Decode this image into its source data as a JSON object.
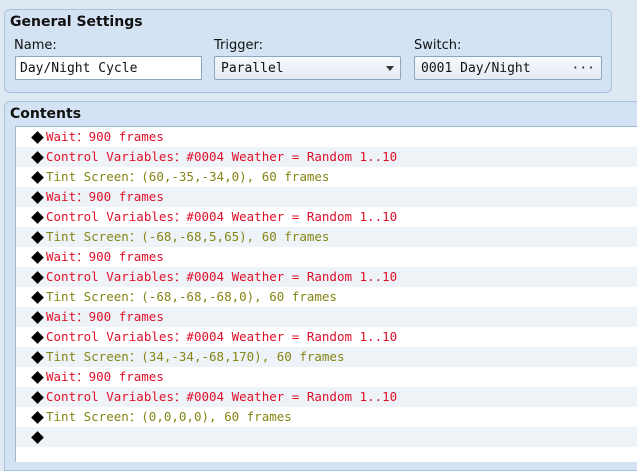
{
  "general": {
    "title": "General Settings",
    "name_label": "Name:",
    "name_value": "Day/Night Cycle",
    "trigger_label": "Trigger:",
    "trigger_value": "Parallel",
    "switch_label": "Switch:",
    "switch_value": "0001 Day/Night",
    "switch_button": "···"
  },
  "contents": {
    "title": "Contents",
    "commands": [
      {
        "text": "Wait：900 frames",
        "color": "#e0102a"
      },
      {
        "text": "Control Variables：#0004 Weather = Random 1..10",
        "color": "#e0102a"
      },
      {
        "text": "Tint Screen：(60,-35,-34,0), 60 frames",
        "color": "#858515"
      },
      {
        "text": "Wait：900 frames",
        "color": "#e0102a"
      },
      {
        "text": "Control Variables：#0004 Weather = Random 1..10",
        "color": "#e0102a"
      },
      {
        "text": "Tint Screen：(-68,-68,5,65), 60 frames",
        "color": "#858515"
      },
      {
        "text": "Wait：900 frames",
        "color": "#e0102a"
      },
      {
        "text": "Control Variables：#0004 Weather = Random 1..10",
        "color": "#e0102a"
      },
      {
        "text": "Tint Screen：(-68,-68,-68,0), 60 frames",
        "color": "#858515"
      },
      {
        "text": "Wait：900 frames",
        "color": "#e0102a"
      },
      {
        "text": "Control Variables：#0004 Weather = Random 1..10",
        "color": "#e0102a"
      },
      {
        "text": "Tint Screen：(34,-34,-68,170), 60 frames",
        "color": "#858515"
      },
      {
        "text": "Wait：900 frames",
        "color": "#e0102a"
      },
      {
        "text": "Control Variables：#0004 Weather = Random 1..10",
        "color": "#e0102a"
      },
      {
        "text": "Tint Screen：(0,0,0,0), 60 frames",
        "color": "#858515"
      },
      {
        "text": "",
        "color": "#000000"
      }
    ]
  }
}
